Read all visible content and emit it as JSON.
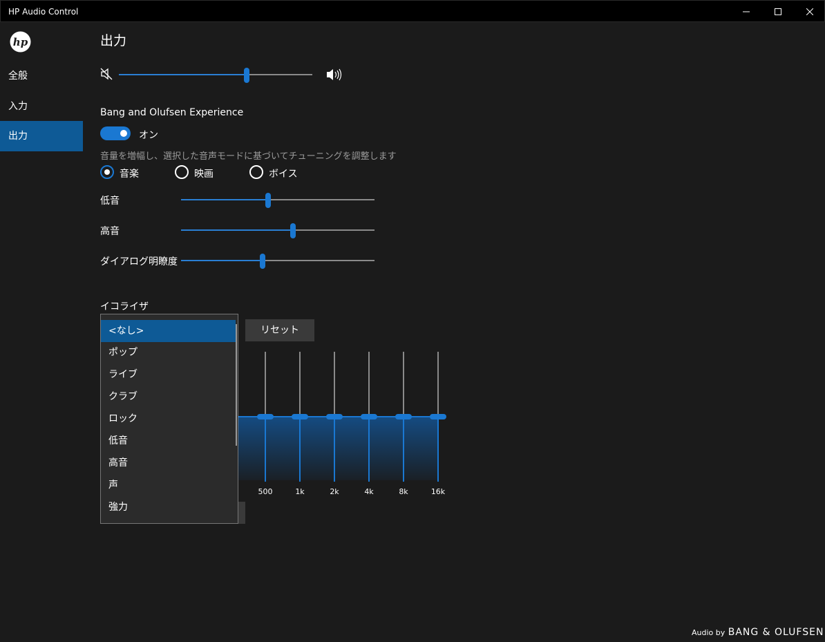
{
  "window": {
    "title": "HP Audio Control"
  },
  "sidebar": {
    "logo_text": "hp",
    "items": [
      {
        "label": "全般",
        "active": false
      },
      {
        "label": "入力",
        "active": false
      },
      {
        "label": "出力",
        "active": true
      }
    ]
  },
  "main": {
    "page_title": "出力",
    "volume_level": 0.66,
    "bo_experience": {
      "label": "Bang and Olufsen Experience",
      "toggle_state": "オン",
      "toggle_on": true,
      "description": "音量を増幅し、選択した音声モードに基づいてチューニングを調整します",
      "modes": [
        {
          "label": "音楽",
          "checked": true
        },
        {
          "label": "映画",
          "checked": false
        },
        {
          "label": "ボイス",
          "checked": false
        }
      ],
      "sliders": [
        {
          "label": "低音",
          "level": 0.45
        },
        {
          "label": "高音",
          "level": 0.58
        },
        {
          "label": "ダイアログ明瞭度",
          "level": 0.42
        }
      ]
    },
    "equalizer": {
      "label": "イコライザ",
      "reset_label": "リセット",
      "preset_options": [
        "<なし>",
        "ポップ",
        "ライブ",
        "クラブ",
        "ロック",
        "低音",
        "高音",
        "声",
        "強力"
      ],
      "selected_preset": "<なし>",
      "bands": [
        {
          "freq": "500",
          "level": 0.5
        },
        {
          "freq": "1k",
          "level": 0.5
        },
        {
          "freq": "2k",
          "level": 0.5
        },
        {
          "freq": "4k",
          "level": 0.5
        },
        {
          "freq": "8k",
          "level": 0.5
        },
        {
          "freq": "16k",
          "level": 0.5
        }
      ]
    }
  },
  "footer": {
    "audio_by": "Audio by",
    "brand": "BANG & OLUFSEN"
  },
  "colors": {
    "accent": "#1a78d2",
    "active_nav": "#0e5a96",
    "background": "#1b1b1b",
    "titlebar": "#000000"
  }
}
